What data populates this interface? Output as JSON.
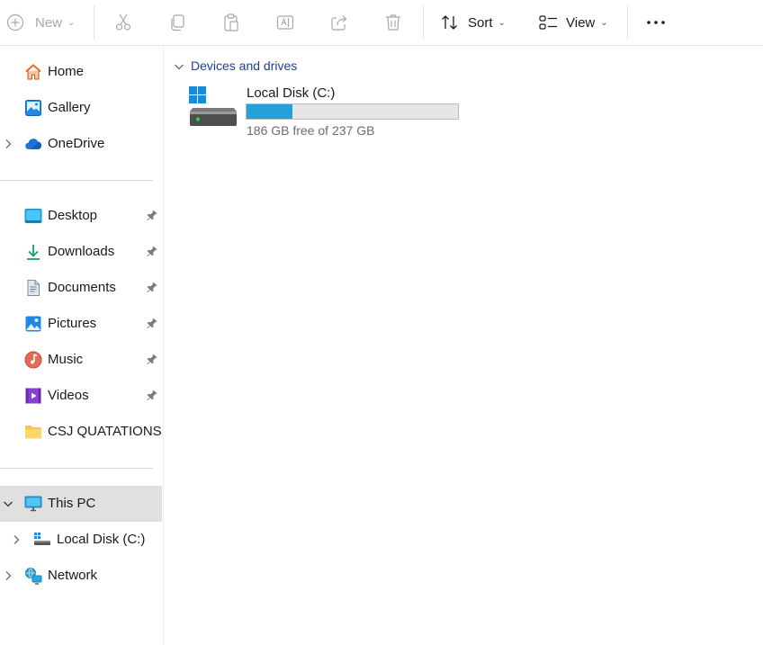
{
  "toolbar": {
    "new_label": "New",
    "sort_label": "Sort",
    "view_label": "View",
    "icons": [
      "plus-icon",
      "cut-icon",
      "copy-icon",
      "paste-icon",
      "rename-icon",
      "share-icon",
      "delete-icon",
      "sort-icon",
      "view-icon",
      "more-icon"
    ]
  },
  "sidebar": {
    "quick": [
      {
        "label": "Home",
        "icon": "home-icon"
      },
      {
        "label": "Gallery",
        "icon": "gallery-icon"
      },
      {
        "label": "OneDrive",
        "icon": "onedrive-cloud-icon"
      }
    ],
    "pinned": [
      {
        "label": "Desktop",
        "icon": "desktop-folder-icon"
      },
      {
        "label": "Downloads",
        "icon": "downloads-icon"
      },
      {
        "label": "Documents",
        "icon": "documents-icon"
      },
      {
        "label": "Pictures",
        "icon": "pictures-icon"
      },
      {
        "label": "Music",
        "icon": "music-icon"
      },
      {
        "label": "Videos",
        "icon": "videos-icon"
      },
      {
        "label": "CSJ QUATATIONS",
        "icon": "folder-icon"
      }
    ],
    "this_pc": {
      "label": "This PC",
      "icon": "this-pc-icon",
      "selected": true
    },
    "local_disk": {
      "label": "Local Disk (C:)",
      "icon": "drive-icon"
    },
    "network": {
      "label": "Network",
      "icon": "network-icon"
    }
  },
  "content": {
    "section_title": "Devices and drives",
    "drive": {
      "name": "Local Disk (C:)",
      "free_text": "186 GB free of 237 GB",
      "free_gb": 186,
      "total_gb": 237,
      "used_fraction": 0.215,
      "bar_color": "#26a0da"
    }
  },
  "colors": {
    "accent": "#26a0da",
    "selected_bg": "#e0e0e0",
    "section_title": "#1f3f8f"
  }
}
